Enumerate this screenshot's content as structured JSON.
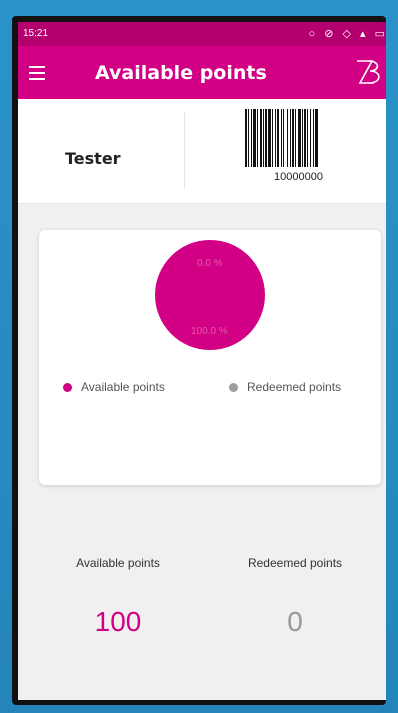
{
  "status_bar": {
    "time": "15:21",
    "icons": "○ ⊘ ◇ ▴ ▭"
  },
  "app_bar": {
    "title": "Available points",
    "logo": "ZB"
  },
  "user": {
    "name": "Tester",
    "barcode_number": "10000000"
  },
  "chart_data": {
    "type": "pie",
    "slices": [
      {
        "name": "Available points",
        "value": 100.0,
        "color": "#d10084"
      },
      {
        "name": "Redeemed points",
        "value": 0.0,
        "color": "#a09c9c"
      }
    ],
    "data_labels": [
      "0.0 %",
      "100.0 %"
    ]
  },
  "legend": {
    "available": "Available points",
    "redeemed": "Redeemed points",
    "available_color": "#d10084",
    "redeemed_color": "#a09c9c"
  },
  "summary": {
    "available_label": "Available points",
    "redeemed_label": "Redeemed points",
    "available_value": "100",
    "redeemed_value": "0",
    "available_color": "#d10084",
    "redeemed_color": "#999999"
  }
}
